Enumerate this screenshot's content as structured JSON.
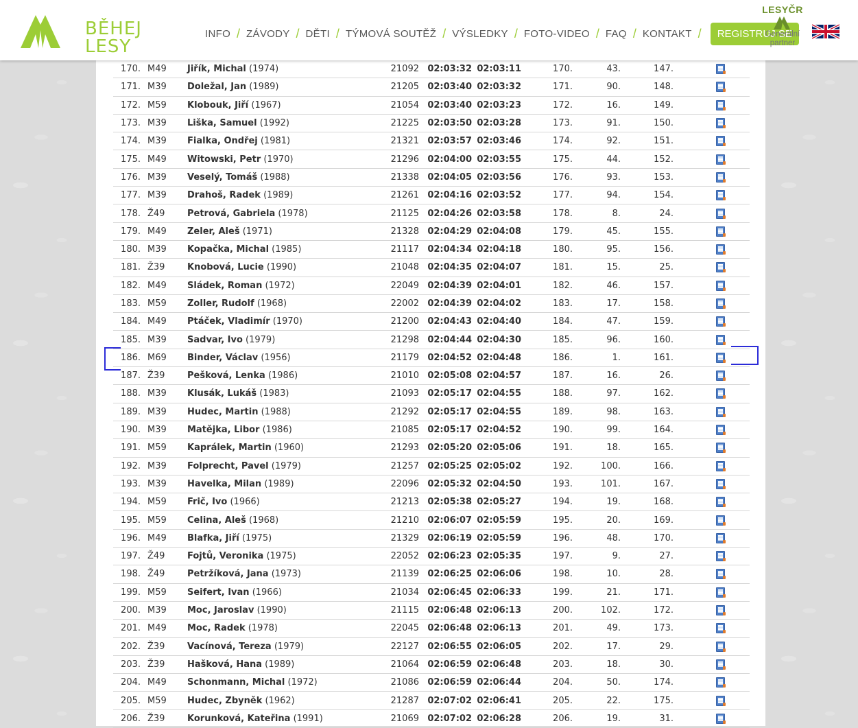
{
  "header": {
    "logo": {
      "line1": "BĚHEJ",
      "line2": "LESY"
    },
    "nav": [
      "INFO",
      "ZÁVODY",
      "DĚTI",
      "TÝMOVÁ SOUTĚŽ",
      "VÝSLEDKY",
      "FOTO-VIDEO",
      "FAQ",
      "KONTAKT"
    ],
    "register_button": "REGISTRUJ SE",
    "partner": {
      "brand": "LESYČR",
      "label_line1": "Generální",
      "label_line2": "partner"
    },
    "language_flag_icon": "uk-flag-icon"
  },
  "colors": {
    "brand_green": "#9ccd36",
    "annotation_blue": "#2b2bd8",
    "result_icon": "document-icon"
  },
  "results": [
    {
      "rank": "170.",
      "cat": "M49",
      "surname": "Jiřík, Michal",
      "year": "(1974)",
      "bib": "21092",
      "time": "02:03:32",
      "net": "02:03:11",
      "p1": "170.",
      "p2": "43.",
      "p3": "147."
    },
    {
      "rank": "171.",
      "cat": "M39",
      "surname": "Doležal, Jan",
      "year": "(1989)",
      "bib": "21205",
      "time": "02:03:40",
      "net": "02:03:32",
      "p1": "171.",
      "p2": "90.",
      "p3": "148."
    },
    {
      "rank": "172.",
      "cat": "M59",
      "surname": "Klobouk, Jiří",
      "year": "(1967)",
      "bib": "21054",
      "time": "02:03:40",
      "net": "02:03:23",
      "p1": "172.",
      "p2": "16.",
      "p3": "149."
    },
    {
      "rank": "173.",
      "cat": "M39",
      "surname": "Liška, Samuel",
      "year": "(1992)",
      "bib": "21225",
      "time": "02:03:50",
      "net": "02:03:28",
      "p1": "173.",
      "p2": "91.",
      "p3": "150."
    },
    {
      "rank": "174.",
      "cat": "M39",
      "surname": "Fialka, Ondřej",
      "year": "(1981)",
      "bib": "21321",
      "time": "02:03:57",
      "net": "02:03:46",
      "p1": "174.",
      "p2": "92.",
      "p3": "151."
    },
    {
      "rank": "175.",
      "cat": "M49",
      "surname": "Witowski, Petr",
      "year": "(1970)",
      "bib": "21296",
      "time": "02:04:00",
      "net": "02:03:55",
      "p1": "175.",
      "p2": "44.",
      "p3": "152."
    },
    {
      "rank": "176.",
      "cat": "M39",
      "surname": "Veselý, Tomáš",
      "year": "(1988)",
      "bib": "21338",
      "time": "02:04:05",
      "net": "02:03:56",
      "p1": "176.",
      "p2": "93.",
      "p3": "153."
    },
    {
      "rank": "177.",
      "cat": "M39",
      "surname": "Drahoš, Radek",
      "year": "(1989)",
      "bib": "21261",
      "time": "02:04:16",
      "net": "02:03:52",
      "p1": "177.",
      "p2": "94.",
      "p3": "154."
    },
    {
      "rank": "178.",
      "cat": "Ž49",
      "surname": "Petrová, Gabriela",
      "year": "(1978)",
      "bib": "21125",
      "time": "02:04:26",
      "net": "02:03:58",
      "p1": "178.",
      "p2": "8.",
      "p3": "24."
    },
    {
      "rank": "179.",
      "cat": "M49",
      "surname": "Zeler, Aleš",
      "year": "(1971)",
      "bib": "21328",
      "time": "02:04:29",
      "net": "02:04:08",
      "p1": "179.",
      "p2": "45.",
      "p3": "155."
    },
    {
      "rank": "180.",
      "cat": "M39",
      "surname": "Kopačka, Michal",
      "year": "(1985)",
      "bib": "21117",
      "time": "02:04:34",
      "net": "02:04:18",
      "p1": "180.",
      "p2": "95.",
      "p3": "156."
    },
    {
      "rank": "181.",
      "cat": "Ž39",
      "surname": "Knobová, Lucie",
      "year": "(1990)",
      "bib": "21048",
      "time": "02:04:35",
      "net": "02:04:07",
      "p1": "181.",
      "p2": "15.",
      "p3": "25."
    },
    {
      "rank": "182.",
      "cat": "M49",
      "surname": "Sládek, Roman",
      "year": "(1972)",
      "bib": "22049",
      "time": "02:04:39",
      "net": "02:04:01",
      "p1": "182.",
      "p2": "46.",
      "p3": "157."
    },
    {
      "rank": "183.",
      "cat": "M59",
      "surname": "Zoller, Rudolf",
      "year": "(1968)",
      "bib": "22002",
      "time": "02:04:39",
      "net": "02:04:02",
      "p1": "183.",
      "p2": "17.",
      "p3": "158."
    },
    {
      "rank": "184.",
      "cat": "M49",
      "surname": "Ptáček, Vladimír",
      "year": "(1970)",
      "bib": "21200",
      "time": "02:04:43",
      "net": "02:04:40",
      "p1": "184.",
      "p2": "47.",
      "p3": "159."
    },
    {
      "rank": "185.",
      "cat": "M39",
      "surname": "Sadvar, Ivo",
      "year": "(1979)",
      "bib": "21298",
      "time": "02:04:44",
      "net": "02:04:30",
      "p1": "185.",
      "p2": "96.",
      "p3": "160."
    },
    {
      "rank": "186.",
      "cat": "M69",
      "surname": "Binder, Václav",
      "year": "(1956)",
      "bib": "21179",
      "time": "02:04:52",
      "net": "02:04:48",
      "p1": "186.",
      "p2": "1.",
      "p3": "161."
    },
    {
      "rank": "187.",
      "cat": "Ž39",
      "surname": "Pešková, Lenka",
      "year": "(1986)",
      "bib": "21010",
      "time": "02:05:08",
      "net": "02:04:57",
      "p1": "187.",
      "p2": "16.",
      "p3": "26."
    },
    {
      "rank": "188.",
      "cat": "M39",
      "surname": "Klusák, Lukáš",
      "year": "(1983)",
      "bib": "21093",
      "time": "02:05:17",
      "net": "02:04:55",
      "p1": "188.",
      "p2": "97.",
      "p3": "162."
    },
    {
      "rank": "189.",
      "cat": "M39",
      "surname": "Hudec, Martin",
      "year": "(1988)",
      "bib": "21292",
      "time": "02:05:17",
      "net": "02:04:55",
      "p1": "189.",
      "p2": "98.",
      "p3": "163."
    },
    {
      "rank": "190.",
      "cat": "M39",
      "surname": "Matějka, Libor",
      "year": "(1986)",
      "bib": "21085",
      "time": "02:05:17",
      "net": "02:04:52",
      "p1": "190.",
      "p2": "99.",
      "p3": "164."
    },
    {
      "rank": "191.",
      "cat": "M59",
      "surname": "Kaprálek, Martin",
      "year": "(1960)",
      "bib": "21293",
      "time": "02:05:20",
      "net": "02:05:06",
      "p1": "191.",
      "p2": "18.",
      "p3": "165."
    },
    {
      "rank": "192.",
      "cat": "M39",
      "surname": "Folprecht, Pavel",
      "year": "(1979)",
      "bib": "21257",
      "time": "02:05:25",
      "net": "02:05:02",
      "p1": "192.",
      "p2": "100.",
      "p3": "166."
    },
    {
      "rank": "193.",
      "cat": "M39",
      "surname": "Havelka, Milan",
      "year": "(1989)",
      "bib": "22096",
      "time": "02:05:32",
      "net": "02:04:50",
      "p1": "193.",
      "p2": "101.",
      "p3": "167."
    },
    {
      "rank": "194.",
      "cat": "M59",
      "surname": "Frič, Ivo",
      "year": "(1966)",
      "bib": "21213",
      "time": "02:05:38",
      "net": "02:05:27",
      "p1": "194.",
      "p2": "19.",
      "p3": "168."
    },
    {
      "rank": "195.",
      "cat": "M59",
      "surname": "Celina, Aleš",
      "year": "(1968)",
      "bib": "21210",
      "time": "02:06:07",
      "net": "02:05:59",
      "p1": "195.",
      "p2": "20.",
      "p3": "169."
    },
    {
      "rank": "196.",
      "cat": "M49",
      "surname": "Blafka, Jiří",
      "year": "(1975)",
      "bib": "21329",
      "time": "02:06:19",
      "net": "02:05:59",
      "p1": "196.",
      "p2": "48.",
      "p3": "170."
    },
    {
      "rank": "197.",
      "cat": "Ž49",
      "surname": "Fojtů, Veronika",
      "year": "(1975)",
      "bib": "22052",
      "time": "02:06:23",
      "net": "02:05:35",
      "p1": "197.",
      "p2": "9.",
      "p3": "27."
    },
    {
      "rank": "198.",
      "cat": "Ž49",
      "surname": "Petržíková, Jana",
      "year": "(1973)",
      "bib": "21139",
      "time": "02:06:25",
      "net": "02:06:06",
      "p1": "198.",
      "p2": "10.",
      "p3": "28."
    },
    {
      "rank": "199.",
      "cat": "M59",
      "surname": "Seifert, Ivan",
      "year": "(1966)",
      "bib": "21034",
      "time": "02:06:45",
      "net": "02:06:33",
      "p1": "199.",
      "p2": "21.",
      "p3": "171."
    },
    {
      "rank": "200.",
      "cat": "M39",
      "surname": "Moc, Jaroslav",
      "year": "(1990)",
      "bib": "21115",
      "time": "02:06:48",
      "net": "02:06:13",
      "p1": "200.",
      "p2": "102.",
      "p3": "172."
    },
    {
      "rank": "201.",
      "cat": "M49",
      "surname": "Moc, Radek",
      "year": "(1978)",
      "bib": "22045",
      "time": "02:06:48",
      "net": "02:06:13",
      "p1": "201.",
      "p2": "49.",
      "p3": "173."
    },
    {
      "rank": "202.",
      "cat": "Ž39",
      "surname": "Vacínová, Tereza",
      "year": "(1979)",
      "bib": "22127",
      "time": "02:06:55",
      "net": "02:06:05",
      "p1": "202.",
      "p2": "17.",
      "p3": "29."
    },
    {
      "rank": "203.",
      "cat": "Ž39",
      "surname": "Hašková, Hana",
      "year": "(1989)",
      "bib": "21064",
      "time": "02:06:59",
      "net": "02:06:48",
      "p1": "203.",
      "p2": "18.",
      "p3": "30."
    },
    {
      "rank": "204.",
      "cat": "M49",
      "surname": "Schonmann, Michal",
      "year": "(1972)",
      "bib": "21086",
      "time": "02:06:59",
      "net": "02:06:44",
      "p1": "204.",
      "p2": "50.",
      "p3": "174."
    },
    {
      "rank": "205.",
      "cat": "M59",
      "surname": "Hudec, Zbyněk",
      "year": "(1962)",
      "bib": "21287",
      "time": "02:07:02",
      "net": "02:06:41",
      "p1": "205.",
      "p2": "22.",
      "p3": "175."
    },
    {
      "rank": "206.",
      "cat": "Ž39",
      "surname": "Korunková, Kateřina",
      "year": "(1991)",
      "bib": "21069",
      "time": "02:07:02",
      "net": "02:06:28",
      "p1": "206.",
      "p2": "19.",
      "p3": "31."
    }
  ]
}
